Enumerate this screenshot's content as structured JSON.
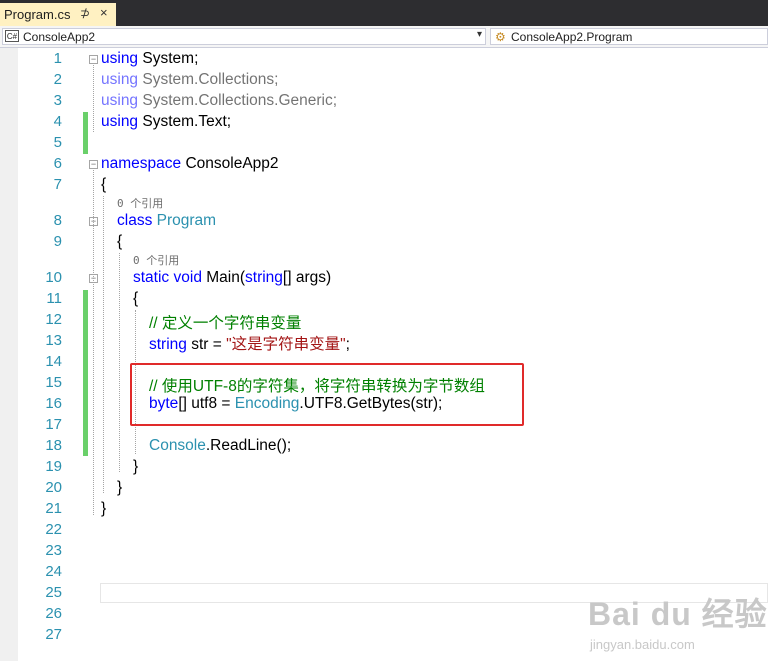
{
  "tab": {
    "title": "Program.cs",
    "pin": "⊅",
    "close": "×"
  },
  "navbar": {
    "project": "ConsoleApp2",
    "project_icon": "C#",
    "member": "ConsoleApp2.Program",
    "dropdown_arrow": "▾"
  },
  "line_numbers": [
    "1",
    "2",
    "3",
    "4",
    "5",
    "6",
    "7",
    "8",
    "9",
    "10",
    "11",
    "12",
    "13",
    "14",
    "15",
    "16",
    "17",
    "18",
    "19",
    "20",
    "21",
    "22",
    "23",
    "24",
    "25",
    "26",
    "27"
  ],
  "references": [
    "0 个引用",
    "0 个引用"
  ],
  "code": {
    "using": "using",
    "sys": "System",
    "semi": ";",
    "sys_collections": "System.Collections",
    "sys_collections_generic": "System.Collections.Generic",
    "sys_text": "System.Text",
    "namespace": "namespace",
    "ns_name": "ConsoleApp2",
    "open_brace": "{",
    "close_brace": "}",
    "class": "class",
    "class_name": "Program",
    "static": "static",
    "void": "void",
    "main": "Main(",
    "string": "string",
    "args": "[] args)",
    "comment1": "// 定义一个字符串变量",
    "str_decl": " str = ",
    "str_value": "\"这是字符串变量\"",
    "comment2": "// 使用UTF-8的字符集，将字符串转换为字节数组",
    "byte": "byte",
    "utf8_decl": "[] utf8 = ",
    "encoding": "Encoding",
    "getbytes": ".UTF8.GetBytes(str);",
    "console": "Console",
    "readline": ".ReadLine();"
  },
  "watermark": {
    "logo": "Bai du 经验",
    "site": "jingyan.baidu.com"
  },
  "colors": {
    "keyword": "#0000ff",
    "type": "#2b91af",
    "comment": "#008000",
    "string": "#a31515",
    "highlight": "#e02a2a"
  }
}
